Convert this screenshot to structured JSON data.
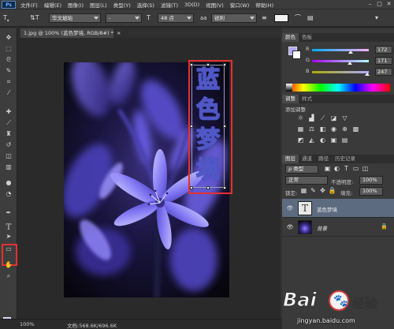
{
  "app": {
    "logo": "Ps",
    "menus": [
      "文件(F)",
      "编辑(E)",
      "图像(I)",
      "图层(L)",
      "类型(Y)",
      "选择(S)",
      "滤镜(T)",
      "3D(D)",
      "视图(V)",
      "窗口(W)",
      "帮助(H)"
    ],
    "window_buttons": [
      "–",
      "□",
      "✕"
    ]
  },
  "options_bar": {
    "font_family": "华文琥珀",
    "font_style": "-",
    "font_size": "48 点",
    "antialias_icon": "aa",
    "antialias": "锐利",
    "text_color": "#f2f2f2"
  },
  "document": {
    "tab_title": "1.jpg @ 100% (蓝色梦境, RGB/8#) *",
    "tab_close": "×",
    "title_chars": [
      "蓝",
      "色",
      "梦",
      "境"
    ]
  },
  "status": {
    "zoom": "100%",
    "doc_size": "文档:568.6K/696.6K"
  },
  "color_panel": {
    "tabs": [
      "颜色",
      "色板"
    ],
    "sliders": [
      {
        "label": "R",
        "value": "172",
        "fraction": 0.674
      },
      {
        "label": "G",
        "value": "171",
        "fraction": 0.671
      },
      {
        "label": "B",
        "value": "247",
        "fraction": 0.969
      }
    ],
    "fg_color": "#aca9ff",
    "bg_color": "#ffffff"
  },
  "adjustments_panel": {
    "tabs": [
      "调整",
      "样式"
    ],
    "add_label": "添加调整"
  },
  "layers_panel": {
    "tabs": [
      "图层",
      "通道",
      "路径",
      "历史记录"
    ],
    "kind_filter": "ρ 类型",
    "blend_mode": "正常",
    "opacity_label": "不透明度:",
    "opacity_value": "100%",
    "lock_label": "锁定:",
    "fill_label": "填充:",
    "fill_value": "100%",
    "layers": [
      {
        "name": "蓝色梦境",
        "type": "text",
        "thumb_letter": "T",
        "selected": true
      },
      {
        "name": "背景",
        "type": "image",
        "selected": false
      }
    ]
  },
  "watermark": {
    "left": "Bai",
    "right": "经验",
    "url": "jingyan.baidu.com"
  }
}
